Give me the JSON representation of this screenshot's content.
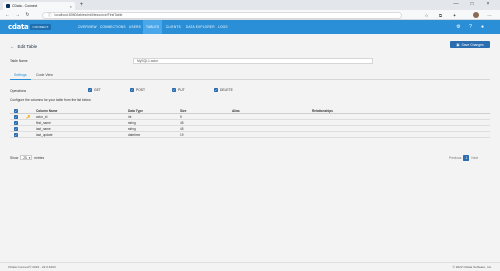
{
  "browser": {
    "tab_title": "CData - Connect",
    "tab_close": "×",
    "new_tab": "+",
    "url": "localhost:8080/tables/edit/tesource/FirstTable",
    "back": "←",
    "forward": "→",
    "reload": "↻",
    "minimize": "—",
    "maximize": "□",
    "close": "×"
  },
  "header": {
    "logo": "cdata",
    "logo_badge": "CONNECT",
    "nav": [
      "OVERVIEW",
      "CONNECTIONS",
      "USERS",
      "TABLES",
      "CLIENTS",
      "DATA EXPLORER",
      "LOGS"
    ],
    "active_nav": "TABLES"
  },
  "page": {
    "back_label": "Edit Table",
    "save_label": "Save Changes",
    "table_name_label": "Table Name",
    "table_name_value": "MySQL1.actor",
    "tabs": [
      "Settings",
      "Code View"
    ],
    "active_tab": "Settings",
    "operations_label": "Operations",
    "operations": [
      "GET",
      "POST",
      "PUT",
      "DELETE"
    ],
    "description": "Configure the columns for your table from the list below."
  },
  "table": {
    "headers": [
      "Column Name",
      "Data Type",
      "Size",
      "Alias",
      "Relationships"
    ],
    "rows": [
      {
        "key": "🔑",
        "name": "actor_id",
        "type": "int",
        "size": "5",
        "alias": "",
        "rel": ""
      },
      {
        "key": "",
        "name": "first_name",
        "type": "string",
        "size": "45",
        "alias": "",
        "rel": ""
      },
      {
        "key": "",
        "name": "last_name",
        "type": "string",
        "size": "45",
        "alias": "",
        "rel": ""
      },
      {
        "key": "",
        "name": "last_update",
        "type": "datetime",
        "size": "19",
        "alias": "",
        "rel": ""
      }
    ],
    "show_label": "Show",
    "show_value": "25",
    "entries_label": "entries",
    "pager_prev": "Previous",
    "pager_current": "1",
    "pager_next": "Next"
  },
  "footer": {
    "left": "CData Connect© 2022 · 22.0.8103",
    "right": "© 2022 CData Software, Inc."
  },
  "colors": {
    "nav_bg": "#2a8fd6",
    "primary_button": "#2a6eb0"
  }
}
